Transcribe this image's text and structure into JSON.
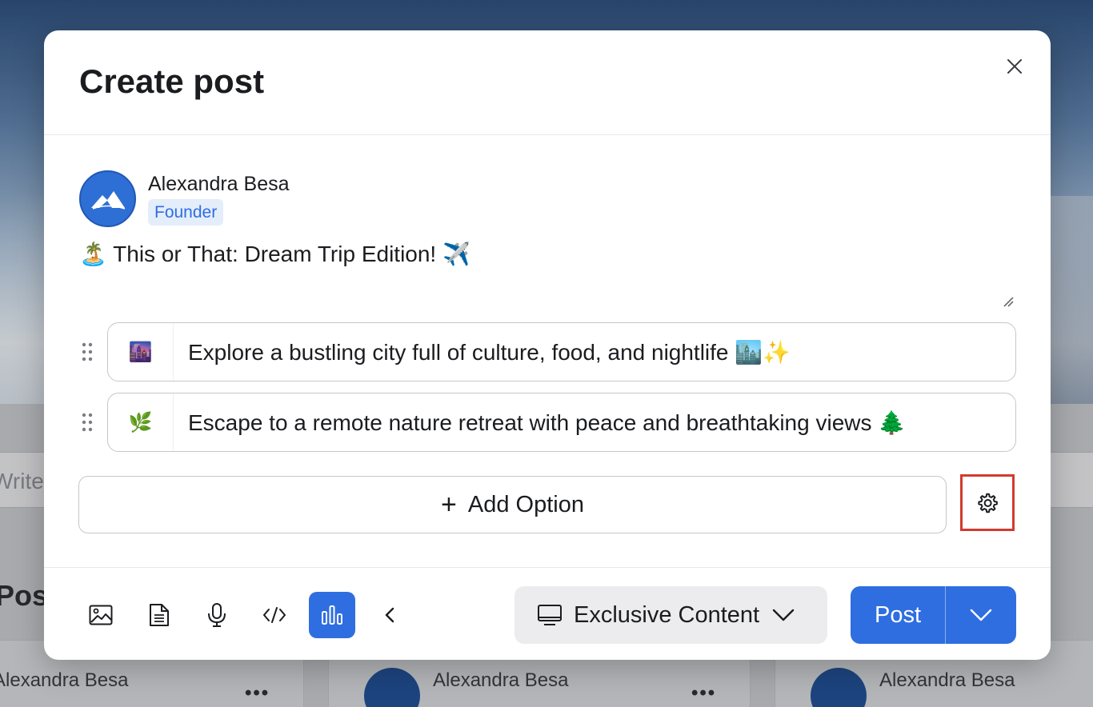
{
  "background": {
    "write_placeholder": "Write",
    "posts_heading": "Posts",
    "cards": [
      {
        "author": "Alexandra Besa"
      },
      {
        "author": "Alexandra Besa"
      },
      {
        "author": "Alexandra Besa"
      }
    ]
  },
  "modal": {
    "title": "Create post",
    "close_icon": "close-icon",
    "author": {
      "name": "Alexandra Besa",
      "role": "Founder",
      "avatar_icon": "mountain-logo"
    },
    "post_text": "🏝️ This or That: Dream Trip Edition! ✈️",
    "poll_options": [
      {
        "emoji": "🌆",
        "text": "Explore a bustling city full of culture, food, and nightlife 🏙️✨"
      },
      {
        "emoji": "🌿",
        "text": "Escape to a remote nature retreat with peace and breathtaking views 🌲"
      }
    ],
    "add_option_label": "Add Option",
    "settings_icon": "gear-icon",
    "toolbar": {
      "tools": [
        "image-icon",
        "document-icon",
        "microphone-icon",
        "code-icon",
        "poll-icon",
        "chevron-left-icon"
      ],
      "active_tool": "poll-icon"
    },
    "audience_label": "Exclusive Content",
    "post_label": "Post"
  },
  "colors": {
    "accent": "#2f6ee0",
    "highlight_border": "#d23a2f"
  }
}
